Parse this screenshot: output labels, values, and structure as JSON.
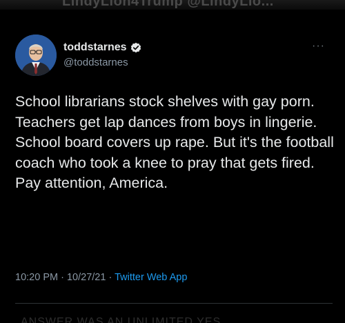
{
  "header_fragment": "LindyLion4Trump @LindyLio...",
  "tweet": {
    "display_name": "toddstarnes",
    "handle": "@toddstarnes",
    "more_label": "···",
    "text": "School librarians stock shelves with gay porn. Teachers get lap dances from boys in lingerie. School board covers up rape. But it's the football coach who took a knee to pray that gets fired. Pay attention, America.",
    "time": "10:20 PM",
    "separator": "·",
    "date": "10/27/21",
    "source": "Twitter Web App"
  },
  "footer_fragment": "ANSWER WAS AN UNLIMITED YES",
  "colors": {
    "background": "#000000",
    "text": "#e7e9ea",
    "muted": "#8b98a5",
    "link": "#1d9bf0"
  },
  "icons": {
    "verified": "verified-badge-icon",
    "more": "more-options-icon"
  }
}
